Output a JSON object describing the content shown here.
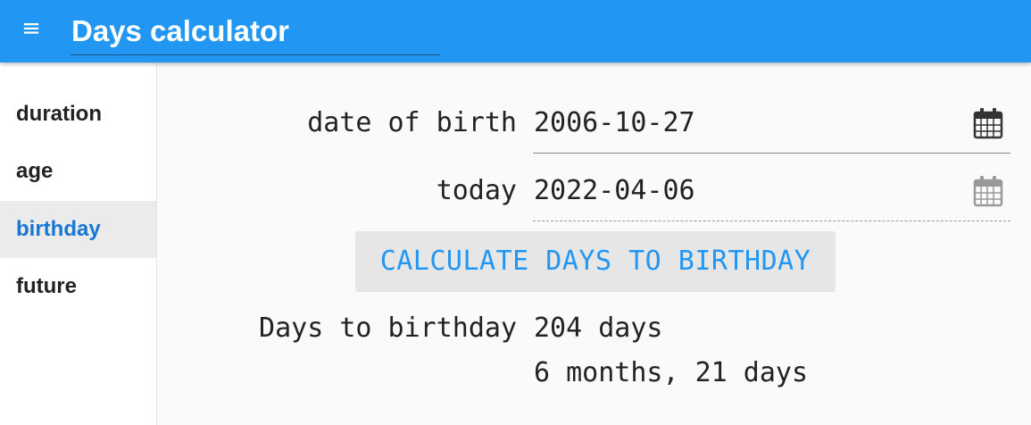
{
  "app_bar": {
    "menu_icon": "hamburger-menu-icon",
    "title": "Days calculator",
    "color": "#2196f3"
  },
  "sidebar": {
    "items": [
      {
        "label": "duration"
      },
      {
        "label": "age"
      },
      {
        "label": "birthday",
        "active": true
      },
      {
        "label": "future"
      }
    ],
    "active_color": "#1976d2"
  },
  "form": {
    "dob_label": "date of birth",
    "dob_value": "2006-10-27",
    "today_label": "today",
    "today_value": "2022-04-06",
    "calendar_icon": "calendar-icon"
  },
  "action": {
    "calculate_label": "CALCULATE DAYS TO BIRTHDAY"
  },
  "result": {
    "label": "Days to birthday",
    "days": "204 days",
    "detail": "6 months, 21 days"
  }
}
